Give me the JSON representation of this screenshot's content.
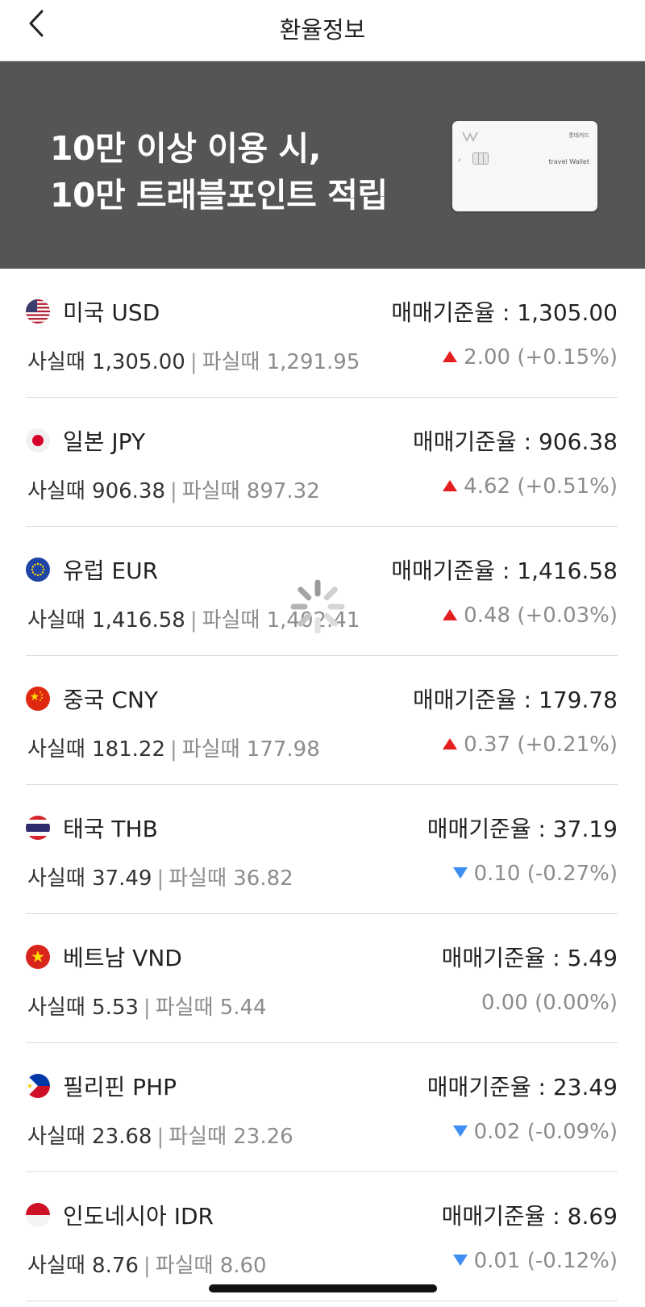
{
  "header": {
    "title": "환율정보",
    "back_icon": "chevron-left-icon"
  },
  "banner": {
    "line1": "10만 이상 이용 시,",
    "line2": "10만 트래블포인트 적립",
    "card_issuer": "롯데카드",
    "card_name": "travel Wallet",
    "background_color": "#555555"
  },
  "rates": [
    {
      "country": "미국 USD",
      "flag": "us-flag-icon",
      "base": "매매기준율 : 1,305.00",
      "buy": "사실때 1,305.00",
      "sell": "파실때 1,291.95",
      "change": "2.00 (+0.15%)",
      "direction": "up"
    },
    {
      "country": "일본 JPY",
      "flag": "jp-flag-icon",
      "base": "매매기준율 : 906.38",
      "buy": "사실때 906.38",
      "sell": "파실때 897.32",
      "change": "4.62 (+0.51%)",
      "direction": "up"
    },
    {
      "country": "유럽 EUR",
      "flag": "eu-flag-icon",
      "base": "매매기준율 : 1,416.58",
      "buy": "사실때 1,416.58",
      "sell": "파실때 1,402.41",
      "change": "0.48 (+0.03%)",
      "direction": "up"
    },
    {
      "country": "중국 CNY",
      "flag": "cn-flag-icon",
      "base": "매매기준율 : 179.78",
      "buy": "사실때 181.22",
      "sell": "파실때 177.98",
      "change": "0.37 (+0.21%)",
      "direction": "up"
    },
    {
      "country": "태국 THB",
      "flag": "th-flag-icon",
      "base": "매매기준율 : 37.19",
      "buy": "사실때 37.49",
      "sell": "파실때 36.82",
      "change": "0.10 (-0.27%)",
      "direction": "down"
    },
    {
      "country": "베트남 VND",
      "flag": "vn-flag-icon",
      "base": "매매기준율 : 5.49",
      "buy": "사실때 5.53",
      "sell": "파실때 5.44",
      "change": "0.00 (0.00%)",
      "direction": "flat"
    },
    {
      "country": "필리핀 PHP",
      "flag": "ph-flag-icon",
      "base": "매매기준율 : 23.49",
      "buy": "사실때 23.68",
      "sell": "파실때 23.26",
      "change": "0.02 (-0.09%)",
      "direction": "down"
    },
    {
      "country": "인도네시아 IDR",
      "flag": "id-flag-icon",
      "base": "매매기준율 : 8.69",
      "buy": "사실때 8.76",
      "sell": "파실때 8.60",
      "change": "0.01 (-0.12%)",
      "direction": "down"
    }
  ],
  "separator": "|",
  "colors": {
    "up": "#e41e1e",
    "down": "#3d8ef2"
  }
}
